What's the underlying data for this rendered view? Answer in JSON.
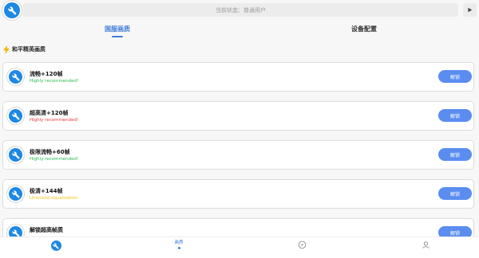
{
  "header": {
    "status_text": "当前状态：普通用户"
  },
  "tabs": [
    {
      "label": "国服画质",
      "active": true
    },
    {
      "label": "设备配置",
      "active": false
    }
  ],
  "section": {
    "title": "和平精英画质",
    "icon": "lightning-icon"
  },
  "cards": [
    {
      "title": "流畅+120帧",
      "subtitle": "Highly recommended!",
      "subtitle_color": "#2dbb4e",
      "button_label": "解锁"
    },
    {
      "title": "超高清+120帧",
      "subtitle": "Highly recommended!",
      "subtitle_color": "#e53935",
      "button_label": "解锁"
    },
    {
      "title": "极限流畅+60帧",
      "subtitle": "Highly recommended!",
      "subtitle_color": "#2dbb4e",
      "button_label": "解锁"
    },
    {
      "title": "极清+144帧",
      "subtitle": "Unlocked equalization",
      "subtitle_color": "#f5c518",
      "button_label": "解锁"
    },
    {
      "title": "解锁超高帧质",
      "subtitle": "",
      "subtitle_color": "#2dbb4e",
      "button_label": "解锁"
    }
  ],
  "bottom_nav": {
    "items": [
      {
        "icon": "wrench-icon",
        "label": ""
      },
      {
        "icon": "image-icon",
        "label": "画质",
        "active": true
      },
      {
        "icon": "compass-icon",
        "label": ""
      },
      {
        "icon": "user-icon",
        "label": ""
      }
    ]
  },
  "colors": {
    "accent": "#3f7bd9",
    "icon_blue": "#1e88e5",
    "button_blue": "#5b8df0",
    "green": "#2dbb4e",
    "red": "#e53935",
    "yellow": "#f5c518"
  }
}
